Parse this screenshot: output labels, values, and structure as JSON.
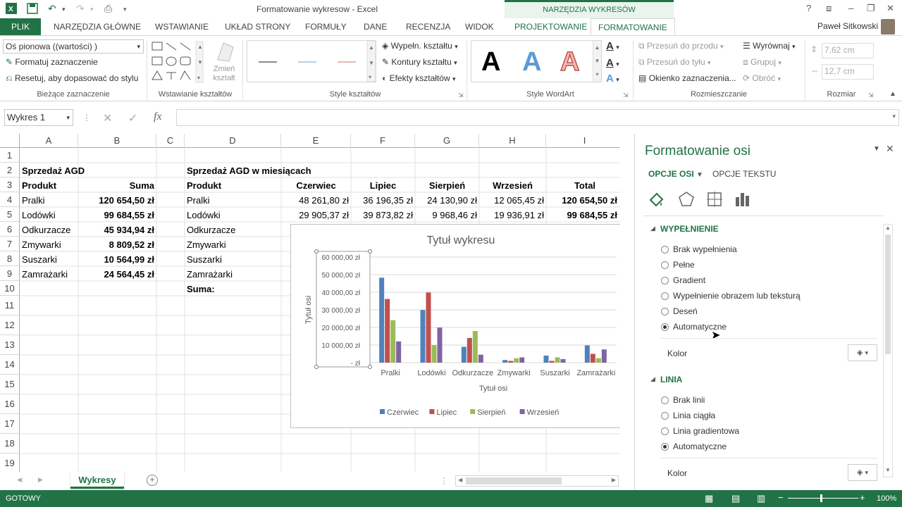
{
  "window": {
    "title": "Formatowanie wykresow - Excel",
    "tools_title": "NARZĘDZIA WYKRESÓW",
    "user": "Paweł Sitkowski"
  },
  "tabs": [
    "PLIK",
    "NARZĘDZIA GŁÓWNE",
    "WSTAWIANIE",
    "UKŁAD STRONY",
    "FORMUŁY",
    "DANE",
    "RECENZJA",
    "WIDOK",
    "PROJEKTOWANIE",
    "FORMATOWANIE"
  ],
  "ribbon": {
    "selection_combo": "Oś pionowa  ((wartości) )",
    "format_selection": "Formatuj zaznaczenie",
    "reset_style": "Resetuj, aby dopasować do stylu",
    "group_current": "Bieżące zaznaczenie",
    "change_shape": "Zmień kształt",
    "group_insert_shapes": "Wstawianie kształtów",
    "shape_fill": "Wypełn. kształtu",
    "shape_outline": "Kontury kształtu",
    "shape_effects": "Efekty kształtów",
    "group_shape_styles": "Style kształtów",
    "wordart_letter": "A",
    "group_wordart": "Style WordArt",
    "bring_forward": "Przesuń do przodu",
    "send_backward": "Przesuń do tyłu",
    "selection_pane": "Okienko zaznaczenia...",
    "align": "Wyrównaj",
    "group": "Grupuj",
    "rotate": "Obróć",
    "group_arrange": "Rozmieszczanie",
    "height": "7,62 cm",
    "width": "12,7 cm",
    "group_size": "Rozmiar"
  },
  "formula_bar": {
    "name_box": "Wykres 1",
    "fx": "fx",
    "formula": ""
  },
  "columns": [
    "A",
    "B",
    "C",
    "D",
    "E",
    "F",
    "G",
    "H",
    "I"
  ],
  "rows": [
    "1",
    "2",
    "3",
    "4",
    "5",
    "6",
    "7",
    "8",
    "9",
    "10",
    "11",
    "12",
    "13",
    "14",
    "15",
    "16",
    "17",
    "18",
    "19"
  ],
  "table_left": {
    "title": "Sprzedaż AGD",
    "hdr_product": "Produkt",
    "hdr_sum": "Suma",
    "rows": [
      {
        "product": "Pralki",
        "sum": "120 654,50 zł"
      },
      {
        "product": "Lodówki",
        "sum": "99 684,55 zł"
      },
      {
        "product": "Odkurzacze",
        "sum": "45 934,94 zł"
      },
      {
        "product": "Zmywarki",
        "sum": "8 809,52 zł"
      },
      {
        "product": "Suszarki",
        "sum": "10 564,99 zł"
      },
      {
        "product": "Zamrażarki",
        "sum": "24 564,45 zł"
      }
    ]
  },
  "table_right": {
    "title": "Sprzedaż AGD w miesiącach",
    "hdr_product": "Produkt",
    "hdr_months": [
      "Czerwiec",
      "Lipiec",
      "Sierpień",
      "Wrzesień",
      "Total"
    ],
    "rows": [
      {
        "product": "Pralki",
        "vals": [
          "48 261,80 zł",
          "36 196,35 zł",
          "24 130,90 zł",
          "12 065,45 zł",
          "120 654,50 zł"
        ]
      },
      {
        "product": "Lodówki",
        "vals": [
          "29 905,37 zł",
          "39 873,82 zł",
          "9 968,46 zł",
          "19 936,91 zł",
          "99 684,55 zł"
        ]
      },
      {
        "product": "Odkurzacze",
        "vals": []
      },
      {
        "product": "Zmywarki",
        "vals": []
      },
      {
        "product": "Suszarki",
        "vals": []
      },
      {
        "product": "Zamrażarki",
        "vals": []
      }
    ],
    "sum_label": "Suma:"
  },
  "chart_data": {
    "type": "bar",
    "title": "Tytuł wykresu",
    "xlabel": "Tytuł osi",
    "ylabel": "Tytuł osi",
    "ylim": [
      0,
      60000
    ],
    "yticks": [
      "60 000,00 zł",
      "50 000,00 zł",
      "40 000,00 zł",
      "30 000,00 zł",
      "20 000,00 zł",
      "10 000,00 zł",
      "-  zł"
    ],
    "categories": [
      "Pralki",
      "Lodówki",
      "Odkurzacze",
      "Zmywarki",
      "Suszarki",
      "Zamrażarki"
    ],
    "series": [
      {
        "name": "Czerwiec",
        "color": "#4f81bd",
        "values": [
          48262,
          29905,
          9000,
          1500,
          4000,
          9800
        ]
      },
      {
        "name": "Lipiec",
        "color": "#c0504d",
        "values": [
          36196,
          39874,
          14000,
          1000,
          1000,
          5000
        ]
      },
      {
        "name": "Sierpień",
        "color": "#9bbb59",
        "values": [
          24131,
          9968,
          18000,
          2500,
          3000,
          2500
        ]
      },
      {
        "name": "Wrzesień",
        "color": "#8064a2",
        "values": [
          12065,
          19937,
          4500,
          3000,
          2000,
          7500
        ]
      }
    ],
    "legend": "bottom",
    "grid": true
  },
  "pane": {
    "title": "Formatowanie osi",
    "tab_axis": "OPCJE OSI",
    "tab_text": "OPCJE TEKSTU",
    "fill_section": "WYPEŁNIENIE",
    "fill_options": [
      "Brak wypełnienia",
      "Pełne",
      "Gradient",
      "Wypełnienie obrazem lub teksturą",
      "Deseń",
      "Automatyczne"
    ],
    "color_label": "Kolor",
    "line_section": "LINIA",
    "line_options": [
      "Brak linii",
      "Linia ciągła",
      "Linia gradientowa",
      "Automatyczne"
    ],
    "color_label2": "Kolor"
  },
  "sheet": {
    "tab": "Wykresy"
  },
  "status": {
    "ready": "GOTOWY",
    "zoom": "100%"
  },
  "colors": {
    "accent": "#217346"
  }
}
